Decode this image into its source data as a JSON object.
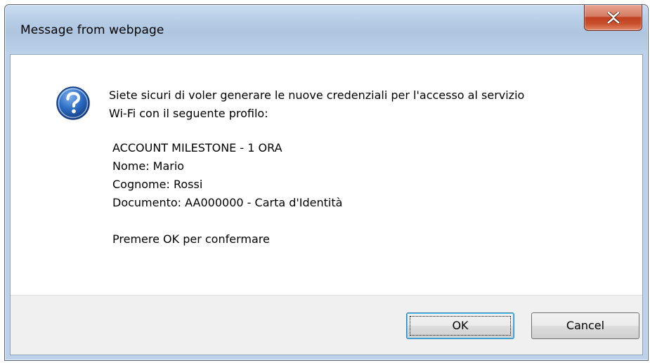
{
  "dialog": {
    "title": "Message from webpage",
    "icon": "question-icon",
    "message": {
      "line1": "Siete sicuri di voler generare le nuove credenziali per l'accesso al servizio",
      "line2": "Wi-Fi con il seguente profilo:",
      "details": [
        "ACCOUNT MILESTONE - 1 ORA",
        "Nome: Mario",
        "Cognome: Rossi",
        "Documento: AA000000 - Carta d'Identità"
      ],
      "confirm": "Premere OK per confermare"
    },
    "buttons": {
      "ok_label": "OK",
      "cancel_label": "Cancel"
    }
  },
  "colors": {
    "close_button": "#c9502d",
    "question_icon": "#1e5aa8",
    "footer_bg": "#f0f0f0"
  }
}
